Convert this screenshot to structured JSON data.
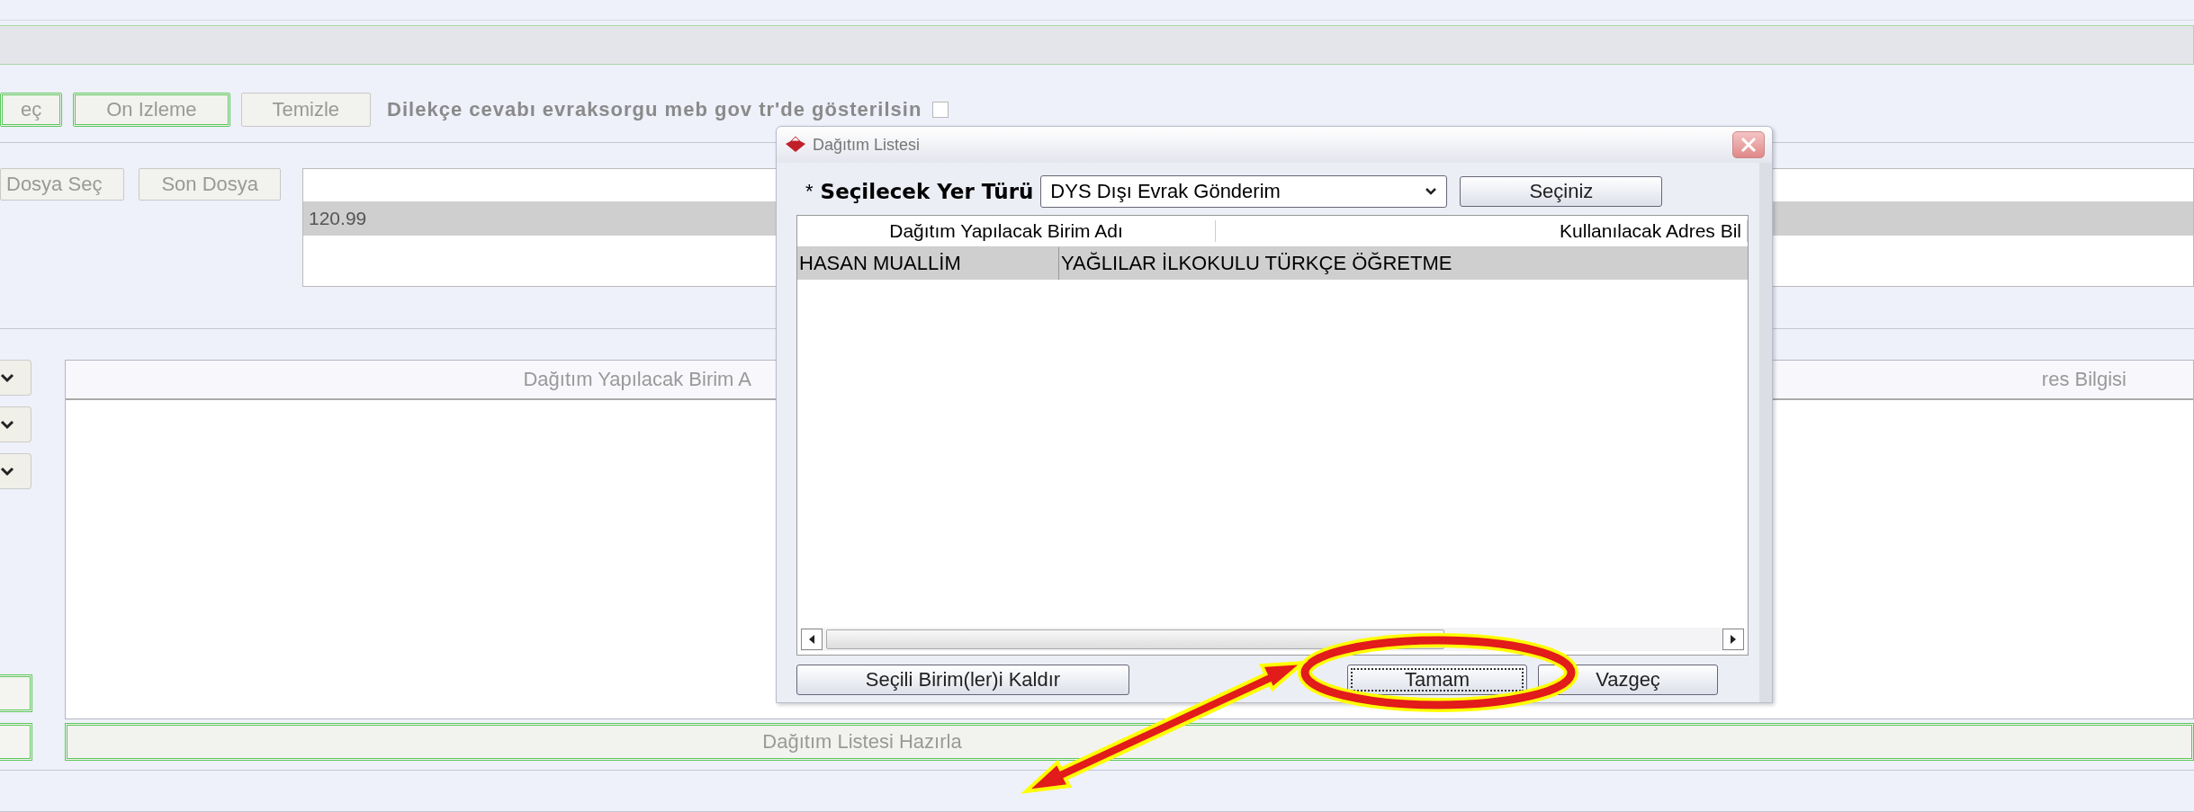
{
  "toolbar": {
    "buttons": [
      {
        "label": "eç",
        "highlighted": true
      },
      {
        "label": "On Izleme",
        "highlighted": true
      },
      {
        "label": "Temizle",
        "highlighted": false
      }
    ],
    "option": {
      "label": "Dilekçe cevabı evraksorgu meb gov tr'de gösterilsin",
      "checked": false
    }
  },
  "file_row": {
    "buttons": [
      "Dosya Seç",
      "Son Dosya"
    ],
    "value": "120.99"
  },
  "main_table": {
    "columns": [
      "Dağıtım Yapılacak Birim A",
      "res Bilgisi"
    ]
  },
  "prepare_button": "Dağıtım Listesi Hazırla",
  "dialog": {
    "title": "Dağıtım Listesi",
    "required_mark": "*",
    "field_label": "Seçilecek Yer Türü",
    "select_value": "DYS Dışı Evrak Gönderim",
    "select_button": "Seçiniz",
    "columns": [
      "Dağıtım Yapılacak Birim Adı",
      "Kullanılacak Adres Bil"
    ],
    "rows": [
      {
        "cells": [
          "HASAN MUALLİM",
          "YAĞLILAR İLKOKULU TÜRKÇE ÖĞRETME"
        ],
        "selected": true
      }
    ],
    "buttons": [
      {
        "label": "Seçili Birim(ler)i Kaldır",
        "focused": false
      },
      {
        "label": "Tamam",
        "focused": true
      },
      {
        "label": "Vazgeç",
        "focused": false
      }
    ]
  }
}
